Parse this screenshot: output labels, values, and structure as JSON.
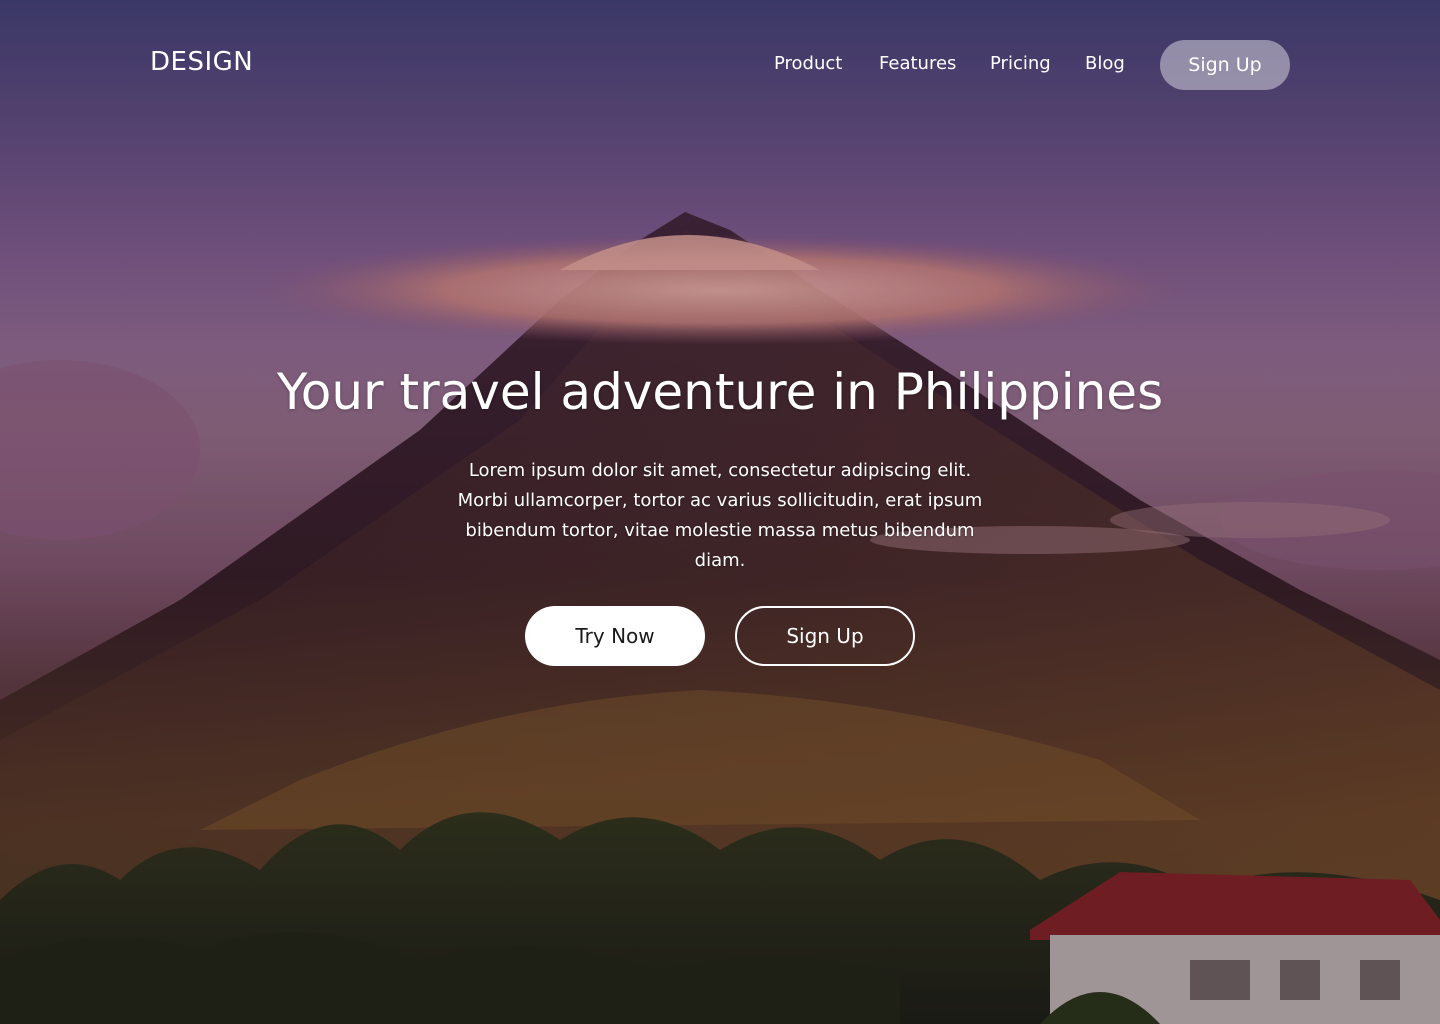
{
  "nav": {
    "logo": "DESIGN",
    "links": [
      "Product",
      "Features",
      "Pricing",
      "Blog"
    ],
    "signup_label": "Sign Up"
  },
  "hero": {
    "headline": "Your travel adventure in Philippines",
    "body": "Lorem ipsum dolor sit amet, consectetur adipiscing elit. Morbi ullamcorper, tortor ac varius sollicitudin, erat ipsum bibendum tortor, vitae molestie massa metus bibendum diam.",
    "primary_button": "Try Now",
    "secondary_button": "Sign Up"
  },
  "colors": {
    "text": "#ffffff",
    "primary_button_bg": "#ffffff",
    "primary_button_text": "#1a1a1a",
    "nav_button_bg": "rgba(255,255,255,0.42)"
  }
}
